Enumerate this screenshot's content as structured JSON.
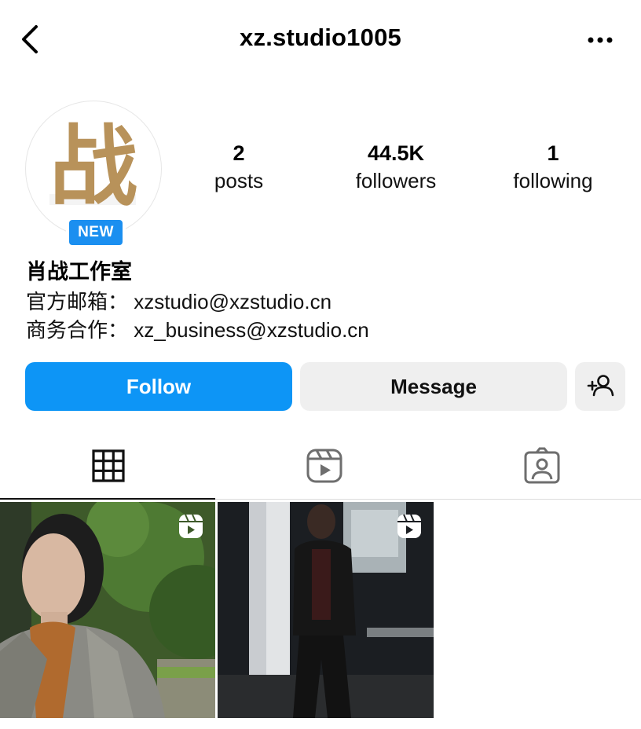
{
  "header": {
    "username": "xz.studio1005",
    "back_icon": "chevron-left-icon",
    "more_icon": "more-horizontal-icon"
  },
  "profile": {
    "avatar_char": "战",
    "badge": "NEW",
    "stats": [
      {
        "value": "2",
        "label": "posts"
      },
      {
        "value": "44.5K",
        "label": "followers"
      },
      {
        "value": "1",
        "label": "following"
      }
    ],
    "full_name": "肖战工作室",
    "bio": [
      "官方邮箱：  xzstudio@xzstudio.cn",
      "商务合作：  xz_business@xzstudio.cn"
    ]
  },
  "actions": {
    "follow": "Follow",
    "message": "Message",
    "add_user_icon": "add-user-icon"
  },
  "tabs": [
    {
      "name": "posts-grid",
      "icon": "grid-icon",
      "active": true
    },
    {
      "name": "reels",
      "icon": "reels-icon",
      "active": false
    },
    {
      "name": "tagged",
      "icon": "tagged-user-icon",
      "active": false
    }
  ],
  "posts": [
    {
      "type": "reel",
      "icon": "reels-icon"
    },
    {
      "type": "reel",
      "icon": "reels-icon"
    }
  ],
  "colors": {
    "accent": "#0d95f6",
    "badge": "#1b8ff0",
    "avatar_glyph": "#b8925a"
  }
}
